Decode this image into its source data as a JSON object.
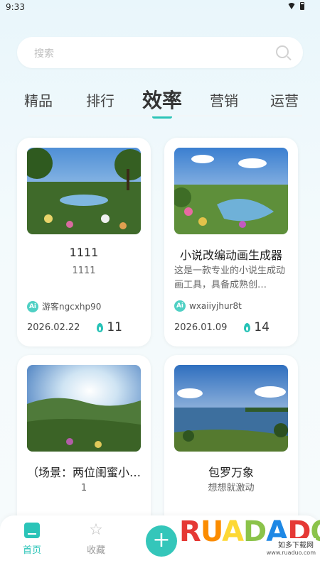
{
  "status": {
    "time": "9:33"
  },
  "search": {
    "placeholder": "搜索"
  },
  "tabs": [
    "精品",
    "排行",
    "效率",
    "营销",
    "运营"
  ],
  "active_tab": "效率",
  "cards": [
    {
      "title": "1111",
      "desc": "1111",
      "author": "游客ngcxhp90",
      "date": "2026.02.22",
      "likes": "11"
    },
    {
      "title": "小说改编动画生成器",
      "desc": "这是一款专业的小说生成动画工具，具备成熟创…",
      "author": "wxaiiyjhur8t",
      "date": "2026.01.09",
      "likes": "14"
    },
    {
      "title": "（场景：两位闺蜜小…",
      "desc": "1",
      "author": "",
      "date": "",
      "likes": ""
    },
    {
      "title": "包罗万象",
      "desc": "想想就激动",
      "author": "",
      "date": "",
      "likes": ""
    }
  ],
  "nav": {
    "home": "首页",
    "favorites": "收藏",
    "add": "+"
  },
  "watermark": {
    "logo": "RUADADO",
    "tagline": "如多下载网",
    "url": "www.ruaduo.com"
  },
  "ai_badge": "Ai",
  "colors": {
    "accent": "#2bc4b8"
  }
}
